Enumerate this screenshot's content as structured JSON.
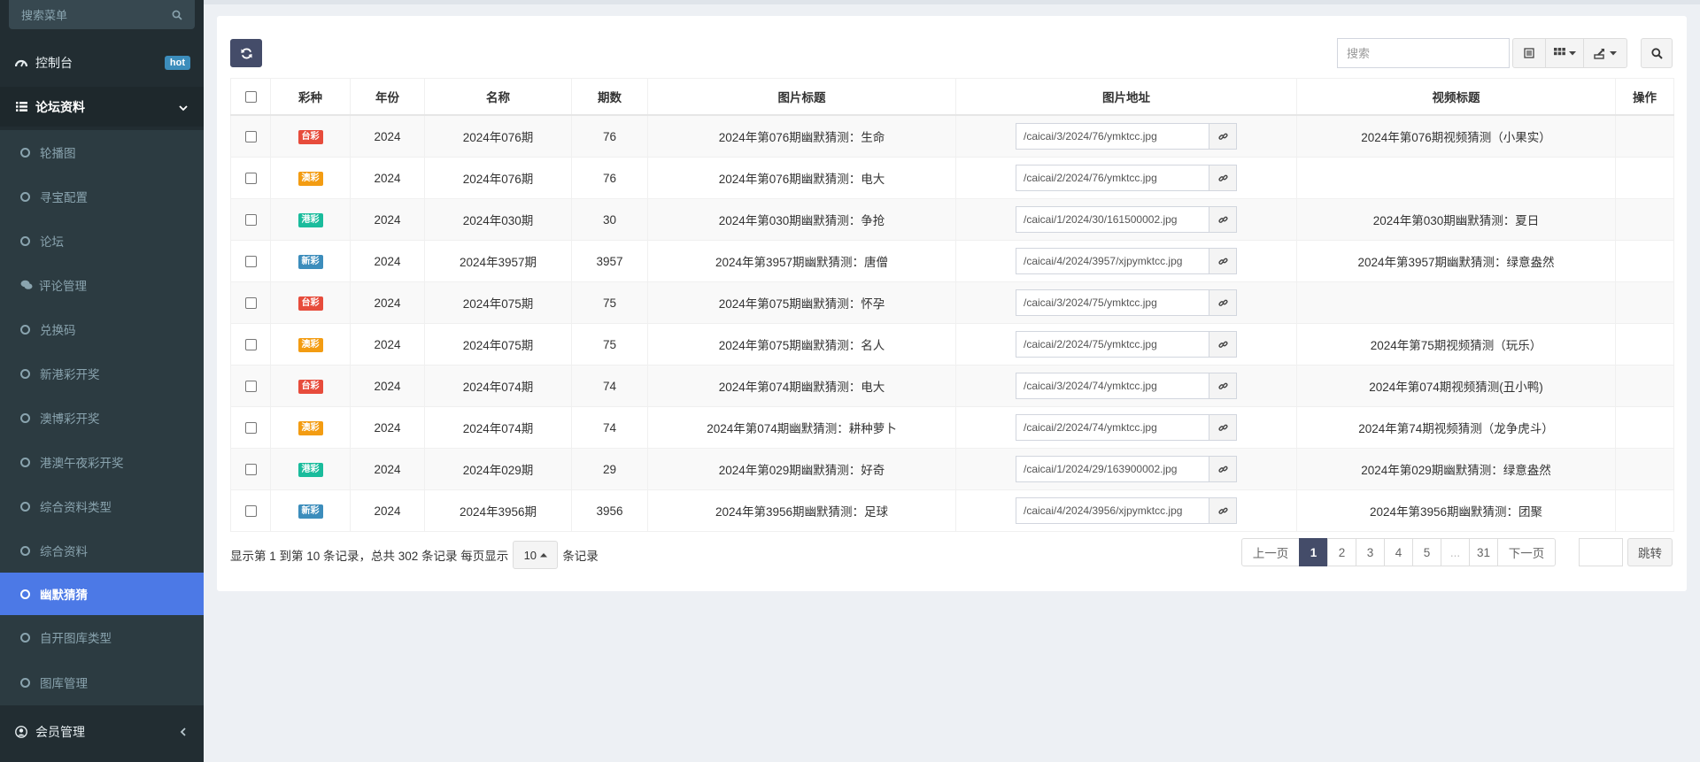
{
  "sidebar": {
    "search_placeholder": "搜索菜单",
    "dashboard": {
      "label": "控制台",
      "badge": "hot"
    },
    "forum": {
      "label": "论坛资料"
    },
    "sub_items": [
      {
        "label": "轮播图"
      },
      {
        "label": "寻宝配置"
      },
      {
        "label": "论坛"
      },
      {
        "label": "评论管理"
      },
      {
        "label": "兑换码"
      },
      {
        "label": "新港彩开奖"
      },
      {
        "label": "澳博彩开奖"
      },
      {
        "label": "港澳午夜彩开奖"
      },
      {
        "label": "综合资料类型"
      },
      {
        "label": "综合资料"
      },
      {
        "label": "幽默猜猜"
      },
      {
        "label": "自开图库类型"
      },
      {
        "label": "图库管理"
      }
    ],
    "members": {
      "label": "会员管理"
    }
  },
  "toolbar": {
    "search_placeholder": "搜索"
  },
  "table": {
    "headers": [
      "彩种",
      "年份",
      "名称",
      "期数",
      "图片标题",
      "图片地址",
      "视频标题",
      "操作"
    ],
    "rows": [
      {
        "type": "台彩",
        "color": "#e74c3c",
        "year": "2024",
        "name": "2024年076期",
        "issue": "76",
        "img_title": "2024年第076期幽默猜测：生命",
        "img_url": "/caicai/3/2024/76/ymktcc.jpg",
        "video_title": "2024年第076期视频猜测（小果实）"
      },
      {
        "type": "澳彩",
        "color": "#f39c12",
        "year": "2024",
        "name": "2024年076期",
        "issue": "76",
        "img_title": "2024年第076期幽默猜测：电大",
        "img_url": "/caicai/2/2024/76/ymktcc.jpg",
        "video_title": ""
      },
      {
        "type": "港彩",
        "color": "#1abc9c",
        "year": "2024",
        "name": "2024年030期",
        "issue": "30",
        "img_title": "2024年第030期幽默猜测：争抢",
        "img_url": "/caicai/1/2024/30/161500002.jpg",
        "video_title": "2024年第030期幽默猜测：夏日"
      },
      {
        "type": "新彩",
        "color": "#3c8dbc",
        "year": "2024",
        "name": "2024年3957期",
        "issue": "3957",
        "img_title": "2024年第3957期幽默猜测：唐僧",
        "img_url": "/caicai/4/2024/3957/xjpymktcc.jpg",
        "video_title": "2024年第3957期幽默猜测：绿意盎然"
      },
      {
        "type": "台彩",
        "color": "#e74c3c",
        "year": "2024",
        "name": "2024年075期",
        "issue": "75",
        "img_title": "2024年第075期幽默猜测：怀孕",
        "img_url": "/caicai/3/2024/75/ymktcc.jpg",
        "video_title": ""
      },
      {
        "type": "澳彩",
        "color": "#f39c12",
        "year": "2024",
        "name": "2024年075期",
        "issue": "75",
        "img_title": "2024年第075期幽默猜测：名人",
        "img_url": "/caicai/2/2024/75/ymktcc.jpg",
        "video_title": "2024年第75期视频猜测（玩乐）"
      },
      {
        "type": "台彩",
        "color": "#e74c3c",
        "year": "2024",
        "name": "2024年074期",
        "issue": "74",
        "img_title": "2024年第074期幽默猜测：电大",
        "img_url": "/caicai/3/2024/74/ymktcc.jpg",
        "video_title": "2024年第074期视频猜测(丑小鸭)"
      },
      {
        "type": "澳彩",
        "color": "#f39c12",
        "year": "2024",
        "name": "2024年074期",
        "issue": "74",
        "img_title": "2024年第074期幽默猜测：耕种萝卜",
        "img_url": "/caicai/2/2024/74/ymktcc.jpg",
        "video_title": "2024年第74期视频猜测（龙争虎斗）"
      },
      {
        "type": "港彩",
        "color": "#1abc9c",
        "year": "2024",
        "name": "2024年029期",
        "issue": "29",
        "img_title": "2024年第029期幽默猜测：好奇",
        "img_url": "/caicai/1/2024/29/163900002.jpg",
        "video_title": "2024年第029期幽默猜测：绿意盎然"
      },
      {
        "type": "新彩",
        "color": "#3c8dbc",
        "year": "2024",
        "name": "2024年3956期",
        "issue": "3956",
        "img_title": "2024年第3956期幽默猜测：足球",
        "img_url": "/caicai/4/2024/3956/xjpymktcc.jpg",
        "video_title": "2024年第3956期幽默猜测：团聚"
      }
    ]
  },
  "footer": {
    "info_prefix": "显示第 1 到第 10 条记录，总共 302 条记录 每页显示",
    "page_size": "10",
    "info_suffix": "条记录",
    "prev": "上一页",
    "pages": [
      "1",
      "2",
      "3",
      "4",
      "5",
      "...",
      "31"
    ],
    "active_page": "1",
    "next": "下一页",
    "jump": "跳转"
  }
}
